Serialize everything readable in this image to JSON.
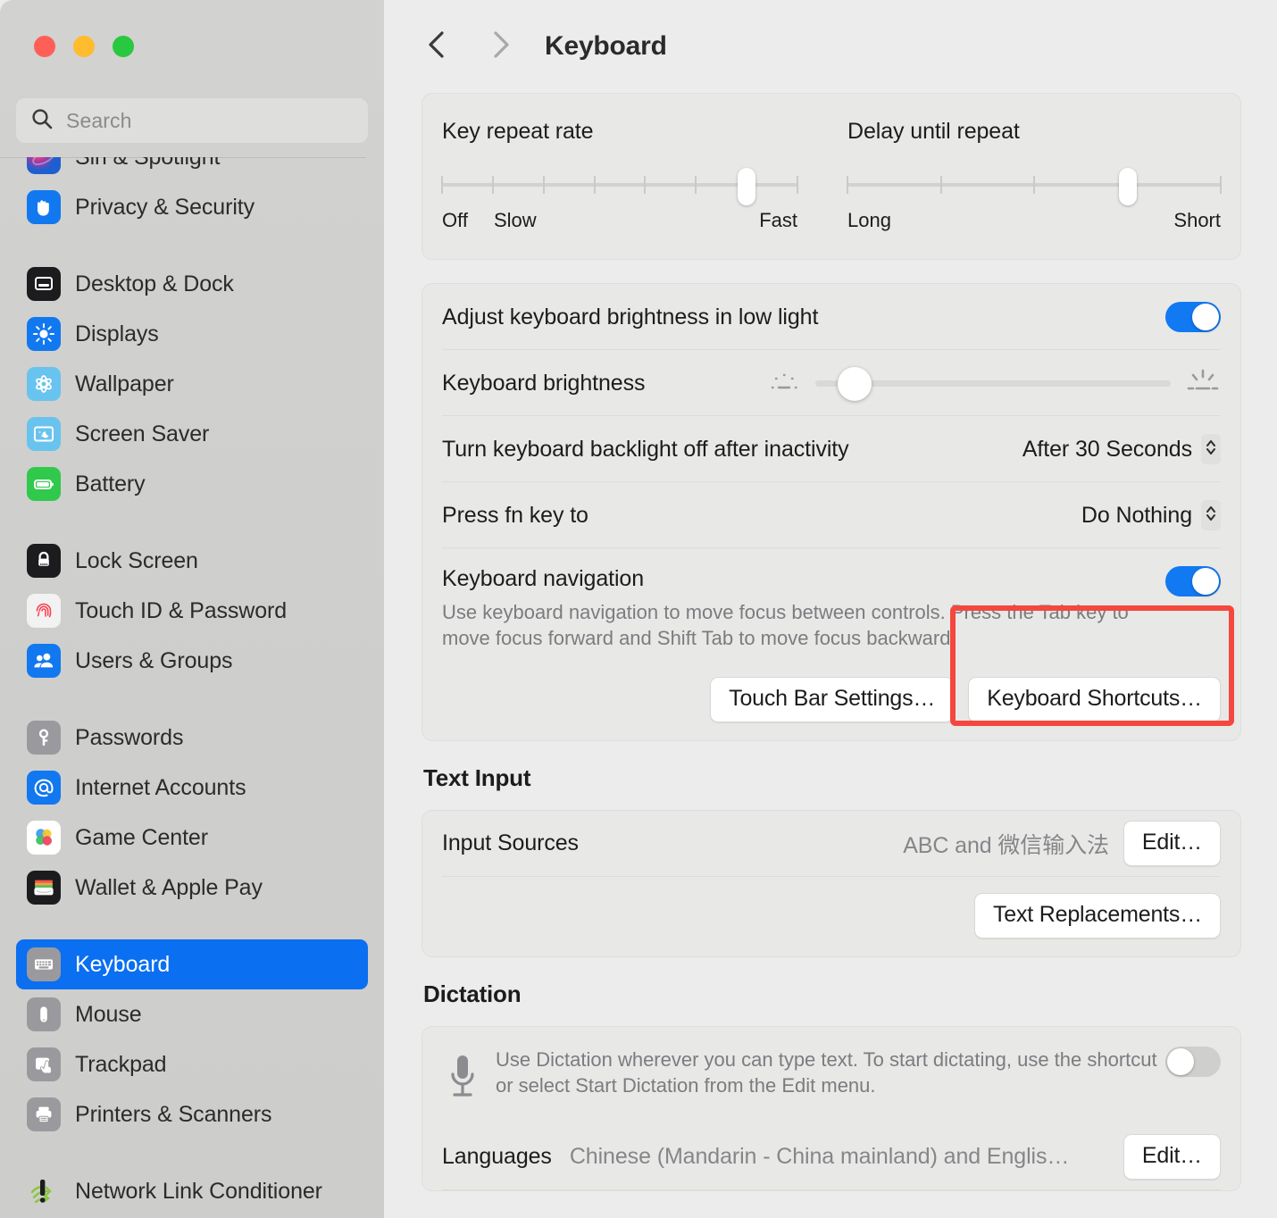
{
  "window": {
    "traffic_lights": [
      "close",
      "minimize",
      "zoom"
    ],
    "colors": {
      "accent_blue": "#0a6ff0",
      "toggle_blue": "#1179f2",
      "annotation_red": "#f4483f",
      "sidebar_bg": "#cfcfcd",
      "content_bg": "#ececec",
      "card_bg": "#e8e8e6"
    }
  },
  "sidebar": {
    "search": {
      "placeholder": "Search",
      "value": "",
      "icon": "search-icon"
    },
    "items": [
      {
        "label": "Siri & Spotlight",
        "icon": "siri-icon",
        "selected": false,
        "partial": true
      },
      {
        "label": "Privacy & Security",
        "icon": "hand-icon",
        "selected": false
      },
      {
        "gap": true
      },
      {
        "label": "Desktop & Dock",
        "icon": "desktop-dock-icon",
        "selected": false
      },
      {
        "label": "Displays",
        "icon": "displays-icon",
        "selected": false
      },
      {
        "label": "Wallpaper",
        "icon": "wallpaper-icon",
        "selected": false
      },
      {
        "label": "Screen Saver",
        "icon": "screen-saver-icon",
        "selected": false
      },
      {
        "label": "Battery",
        "icon": "battery-icon",
        "selected": false
      },
      {
        "gap": true
      },
      {
        "label": "Lock Screen",
        "icon": "lock-icon",
        "selected": false
      },
      {
        "label": "Touch ID & Password",
        "icon": "fingerprint-icon",
        "selected": false
      },
      {
        "label": "Users & Groups",
        "icon": "users-icon",
        "selected": false
      },
      {
        "gap": true
      },
      {
        "label": "Passwords",
        "icon": "key-icon",
        "selected": false
      },
      {
        "label": "Internet Accounts",
        "icon": "at-sign-icon",
        "selected": false
      },
      {
        "label": "Game Center",
        "icon": "game-center-icon",
        "selected": false
      },
      {
        "label": "Wallet & Apple Pay",
        "icon": "wallet-icon",
        "selected": false
      },
      {
        "gap": true
      },
      {
        "label": "Keyboard",
        "icon": "keyboard-icon",
        "selected": true
      },
      {
        "label": "Mouse",
        "icon": "mouse-icon",
        "selected": false
      },
      {
        "label": "Trackpad",
        "icon": "trackpad-icon",
        "selected": false
      },
      {
        "label": "Printers & Scanners",
        "icon": "printer-icon",
        "selected": false
      },
      {
        "gap": true
      },
      {
        "label": "Network Link Conditioner",
        "icon": "network-link-conditioner-icon",
        "selected": false,
        "plain": true
      }
    ]
  },
  "toolbar": {
    "back_icon": "chevron-left-icon",
    "forward_icon": "chevron-right-icon",
    "title": "Keyboard"
  },
  "main": {
    "key_repeat": {
      "title": "Key repeat rate",
      "ticks": 8,
      "knob_index": 6,
      "legend_left": "Off",
      "legend_left2": "Slow",
      "legend_right": "Fast"
    },
    "delay_repeat": {
      "title": "Delay until repeat",
      "ticks": 5,
      "knob_index": 3,
      "legend_left": "Long",
      "legend_right": "Short"
    },
    "adjust_brightness": {
      "label": "Adjust keyboard brightness in low light",
      "toggle_state": "on"
    },
    "keyboard_brightness": {
      "label": "Keyboard brightness",
      "value_percent": 11,
      "icon_low": "brightness-low-icon",
      "icon_high": "brightness-high-icon"
    },
    "backlight_off": {
      "label": "Turn keyboard backlight off after inactivity",
      "value": "After 30 Seconds",
      "stepper_icon": "chevron-up-down-icon"
    },
    "fn_key": {
      "label": "Press fn key to",
      "value": "Do Nothing",
      "stepper_icon": "chevron-up-down-icon"
    },
    "keyboard_navigation": {
      "title": "Keyboard navigation",
      "description": "Use keyboard navigation to move focus between controls. Press the Tab key to move focus forward and Shift Tab to move focus backward.",
      "toggle_state": "on"
    },
    "buttons": {
      "touch_bar": "Touch Bar Settings…",
      "keyboard_shortcuts": "Keyboard Shortcuts…"
    },
    "text_input": {
      "section_title": "Text Input",
      "input_sources_label": "Input Sources",
      "input_sources_value": "ABC and 微信输入法",
      "edit_button": "Edit…",
      "text_replacements_button": "Text Replacements…"
    },
    "dictation": {
      "section_title": "Dictation",
      "description": "Use Dictation wherever you can type text. To start dictating, use the shortcut or select Start Dictation from the Edit menu.",
      "toggle_state": "off",
      "mic_icon": "microphone-icon",
      "languages_label": "Languages",
      "languages_value": "Chinese (Mandarin - China mainland) and Englis…",
      "languages_edit_button": "Edit…"
    }
  },
  "annotation": {
    "shape": "rectangle",
    "color": "#f4483f",
    "target": "keyboard-shortcuts-button"
  }
}
